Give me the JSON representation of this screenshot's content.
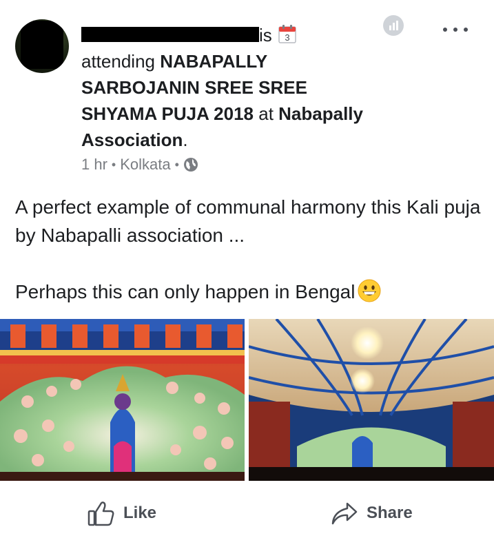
{
  "header": {
    "verb": "is",
    "calendar_day": "3",
    "attending_label": "attending",
    "event_name": "NABAPALLY SARBOJANIN SREE SREE SHYAMA PUJA 2018",
    "at_label": "at",
    "place_name": "Nabapally Association",
    "period": "."
  },
  "meta": {
    "time": "1 hr",
    "separator": "•",
    "location": "Kolkata",
    "separator2": "•"
  },
  "post": {
    "line1": "A perfect example of communal harmony this Kali puja by Nabapalli association ...",
    "line2": "Perhaps this can only happen in Bengal"
  },
  "actions": {
    "like_label": "Like",
    "share_label": "Share"
  },
  "icons": {
    "calendar": "calendar-icon",
    "globe": "globe-icon",
    "more": "more-options-icon",
    "stats": "stats-icon",
    "like": "thumbs-up-icon",
    "share": "share-arrow-icon",
    "emoji": "grinning-face-emoji"
  },
  "colors": {
    "text": "#1c1e21",
    "meta": "#7a7d82",
    "action": "#4b4f56"
  }
}
